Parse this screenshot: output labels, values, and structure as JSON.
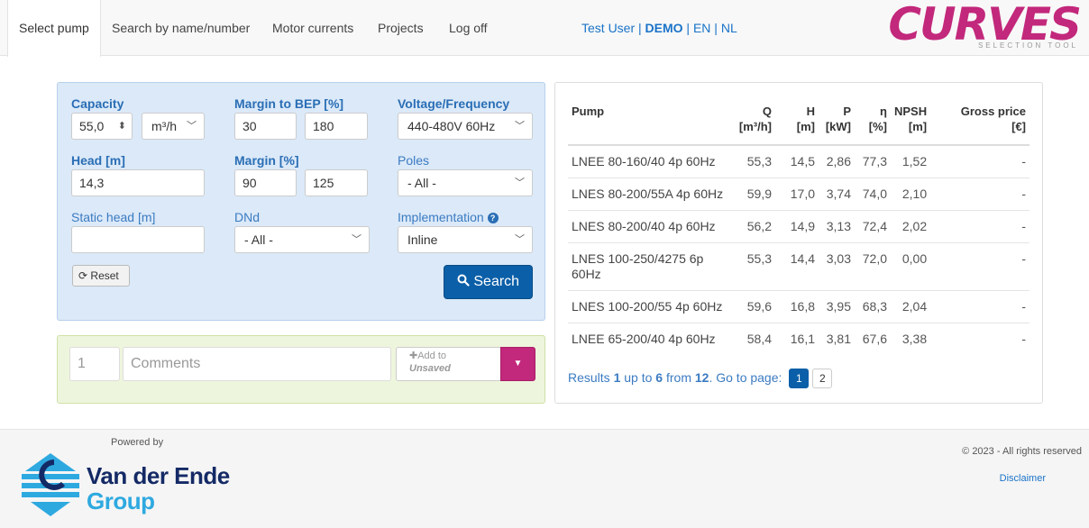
{
  "nav": {
    "tabs": [
      "Select pump",
      "Search by name/number",
      "Motor currents",
      "Projects",
      "Log off"
    ],
    "active_tab": "Select pump",
    "user": "Test User",
    "sep1": " | ",
    "mode": "DEMO",
    "sep2": " | ",
    "lang_en": "EN",
    "sep3": " | ",
    "lang_nl": "NL"
  },
  "logo": {
    "text": "CURVES",
    "subtitle": "SELECTION TOOL"
  },
  "form": {
    "capacity_label": "Capacity",
    "capacity_value": "55,0",
    "capacity_unit": "m³/h",
    "margin_bep_label": "Margin to BEP [%]",
    "margin_bep_min": "30",
    "margin_bep_max": "180",
    "voltage_label": "Voltage/Frequency",
    "voltage_value": "440-480V 60Hz",
    "head_label": "Head [m]",
    "head_value": "14,3",
    "margin_label": "Margin [%]",
    "margin_min": "90",
    "margin_max": "125",
    "poles_label": "Poles",
    "poles_value": "- All -",
    "static_head_label": "Static head [m]",
    "static_head_value": "",
    "dnd_label": "DNd",
    "dnd_value": "- All -",
    "implementation_label": "Implementation",
    "implementation_value": "Inline",
    "reset_label": "Reset",
    "search_label": "Search"
  },
  "project": {
    "number": "1",
    "comments_placeholder": "Comments",
    "add_label": "Add to",
    "add_target": "Unsaved"
  },
  "results": {
    "columns": [
      {
        "l1": "Pump",
        "l2": ""
      },
      {
        "l1": "Q",
        "l2": "[m³/h]"
      },
      {
        "l1": "H",
        "l2": "[m]"
      },
      {
        "l1": "P",
        "l2": "[kW]"
      },
      {
        "l1": "η",
        "l2": "[%]"
      },
      {
        "l1": "NPSH",
        "l2": "[m]"
      },
      {
        "l1": "Gross price",
        "l2": "[€]"
      }
    ],
    "rows": [
      [
        "LNEE 80-160/40 4p 60Hz",
        "55,3",
        "14,5",
        "2,86",
        "77,3",
        "1,52",
        "-"
      ],
      [
        "LNES 80-200/55A 4p 60Hz",
        "59,9",
        "17,0",
        "3,74",
        "74,0",
        "2,10",
        "-"
      ],
      [
        "LNES 80-200/40 4p 60Hz",
        "56,2",
        "14,9",
        "3,13",
        "72,4",
        "2,02",
        "-"
      ],
      [
        "LNES 100-250/4275 6p 60Hz",
        "55,3",
        "14,4",
        "3,03",
        "72,0",
        "0,00",
        "-"
      ],
      [
        "LNES 100-200/55 4p 60Hz",
        "59,6",
        "16,8",
        "3,95",
        "68,3",
        "2,04",
        "-"
      ],
      [
        "LNEE 65-200/40 4p 60Hz",
        "58,4",
        "16,1",
        "3,81",
        "67,6",
        "3,38",
        "-"
      ]
    ],
    "pager_prefix": "Results ",
    "pager_from": "1",
    "pager_mid1": " up to ",
    "pager_to": "6",
    "pager_mid2": " from ",
    "pager_total": "12",
    "pager_suffix": ". Go to page:",
    "pages": [
      "1",
      "2"
    ]
  },
  "footer": {
    "powered_by": "Powered by",
    "brand_line1": "Van der Ende",
    "brand_line2": "Group",
    "copyright": "© 2023 - All rights reserved",
    "disclaimer": "Disclaimer"
  },
  "colors": {
    "accent": "#0b5fa8",
    "brand": "#c2287b",
    "form_bg": "#dbe9f8",
    "project_bg": "#eef5dd"
  },
  "icons": {
    "reset": "refresh-icon",
    "search": "search-icon",
    "info": "info-icon",
    "add": "plus-icon",
    "dropdown": "caret-down-icon"
  }
}
